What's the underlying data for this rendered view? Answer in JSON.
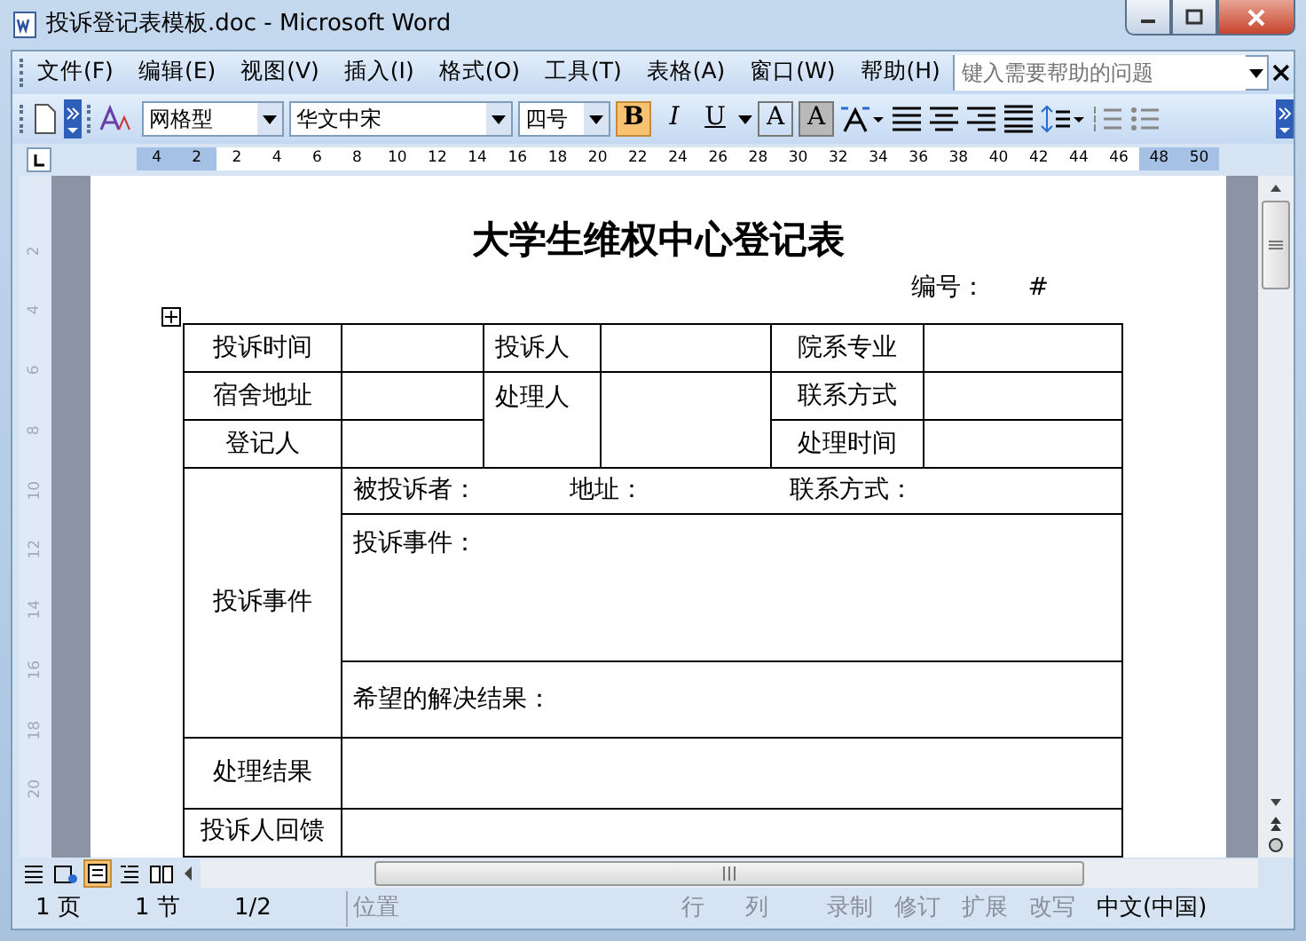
{
  "window": {
    "title": "投诉登记表模板.doc - Microsoft Word"
  },
  "menu": [
    "文件(F)",
    "编辑(E)",
    "视图(V)",
    "插入(I)",
    "格式(O)",
    "工具(T)",
    "表格(A)",
    "窗口(W)",
    "帮助(H)"
  ],
  "help_search": {
    "placeholder": "键入需要帮助的问题"
  },
  "toolbar": {
    "style": "网格型",
    "font": "华文中宋",
    "size": "四号",
    "format_buttons": [
      {
        "label": "B",
        "selected": true
      },
      {
        "label": "I",
        "selected": false
      },
      {
        "label": "U",
        "selected": false
      }
    ],
    "char_buttons": [
      "A",
      "A"
    ]
  },
  "ruler": {
    "numbers": [
      "4",
      "2",
      "2",
      "4",
      "6",
      "8",
      "10",
      "12",
      "14",
      "16",
      "18",
      "20",
      "22",
      "24",
      "26",
      "28",
      "30",
      "32",
      "34",
      "36",
      "38",
      "40",
      "42",
      "44",
      "46",
      "48",
      "50"
    ],
    "vertical_numbers": [
      "2",
      "4",
      "6",
      "8",
      "10",
      "12",
      "14",
      "16",
      "18",
      "20"
    ]
  },
  "document": {
    "heading": "大学生维权中心登记表",
    "number_label": "编号：",
    "number_value": "#",
    "labels": [
      "投诉时间",
      "投诉人",
      "院系专业",
      "宿舍地址",
      "处理人",
      "联系方式",
      "登记人",
      "处理时间"
    ],
    "complaint": {
      "label": "投诉事件",
      "line_items": [
        "被投诉者：",
        "地址：",
        "联系方式："
      ],
      "event_prompt": "投诉事件：",
      "result_prompt": "希望的解决结果："
    },
    "result_label": "处理结果",
    "feedback_label": "投诉人回馈"
  },
  "view_buttons": [
    {
      "selected": false
    },
    {
      "selected": false
    },
    {
      "selected": true
    },
    {
      "selected": false
    },
    {
      "selected": false
    }
  ],
  "status_bar": [
    {
      "text": "1 页",
      "disabled": false
    },
    {
      "text": "1 节",
      "disabled": false
    },
    {
      "text": "1/2",
      "disabled": false
    },
    {
      "text": "位置",
      "disabled": true
    },
    {
      "text": "行",
      "disabled": true
    },
    {
      "text": "列",
      "disabled": true
    },
    {
      "text": "录制",
      "disabled": true
    },
    {
      "text": "修订",
      "disabled": true
    },
    {
      "text": "扩展",
      "disabled": true
    },
    {
      "text": "改写",
      "disabled": true
    },
    {
      "text": "中文(中国)",
      "disabled": false
    }
  ]
}
